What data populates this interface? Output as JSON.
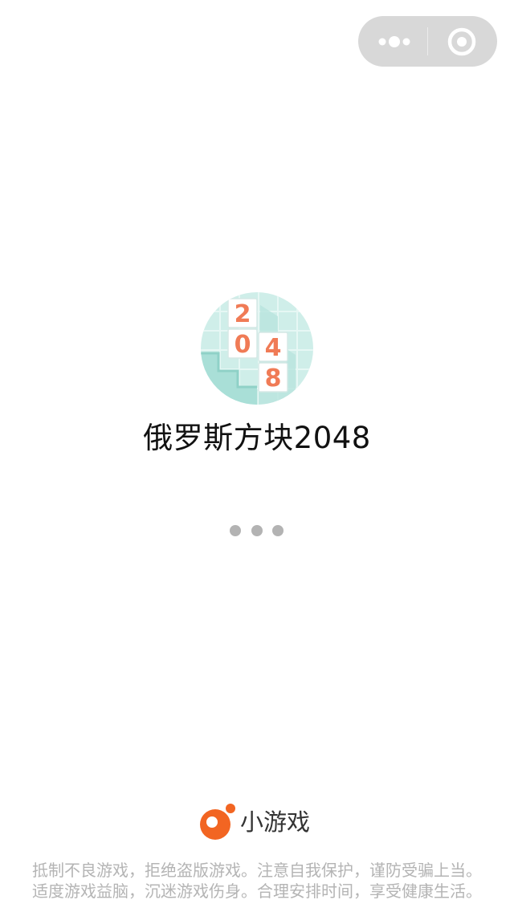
{
  "capsule": {
    "more_icon": "more-dots-icon",
    "close_icon": "target-close-icon"
  },
  "app": {
    "icon": "tetris-2048-icon",
    "icon_tiles": [
      "2",
      "0",
      "4",
      "8"
    ],
    "title": "俄罗斯方块2048"
  },
  "loading": {
    "dots": 3
  },
  "footer": {
    "brand_logo": "minigame-logo-icon",
    "brand_name": "小游戏",
    "notice_line1": "抵制不良游戏，拒绝盗版游戏。注意自我保护，谨防受骗上当。",
    "notice_line2": "适度游戏益脑，沉迷游戏伤身。合理安排时间，享受健康生活。"
  },
  "colors": {
    "capsule_bg": "#d8d8d8",
    "brand_orange": "#f26522",
    "tile_text": "#f07b56",
    "icon_bg": "#c9ece6",
    "notice_text": "#b4b4b4"
  }
}
